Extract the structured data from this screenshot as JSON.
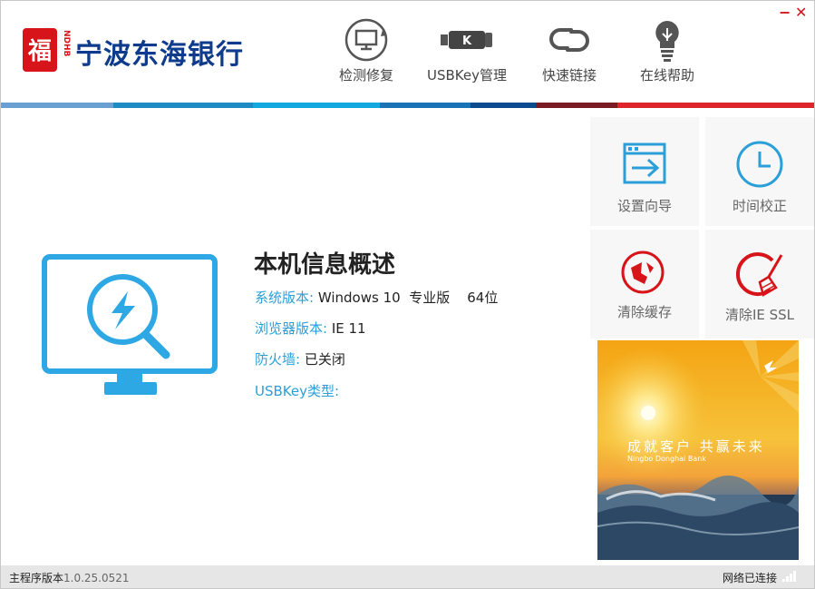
{
  "brand": {
    "name": "宁波东海银行",
    "seal_mark": "NDHB",
    "seal_glyph": "福",
    "colors": {
      "red": "#d7141a",
      "navy": "#0e3b8c",
      "accent_blue": "#2b9fd8"
    }
  },
  "window_controls": {
    "minimize": "−",
    "close": "✕"
  },
  "nav": [
    {
      "label": "检测修复",
      "icon": "monitor-refresh-icon"
    },
    {
      "label": "USBKey管理",
      "icon": "usb-key-icon",
      "badge": "K"
    },
    {
      "label": "快速链接",
      "icon": "link-icon"
    },
    {
      "label": "在线帮助",
      "icon": "lightbulb-icon"
    }
  ],
  "header_stripe_colors": [
    "#6a9fd4",
    "#1e8bc3",
    "#12a8e0",
    "#1a73b5",
    "#0a4b8f",
    "#1d2f6a",
    "#7a1a22",
    "#e0242b"
  ],
  "info": {
    "title": "本机信息概述",
    "os_label": "系统版本:",
    "os_value": "Windows 10  专业版    64位",
    "browser_label": "浏览器版本:",
    "browser_value": "IE 11",
    "firewall_label": "防火墙:",
    "firewall_value": "已关闭",
    "usbkey_label": "USBKey类型:",
    "usbkey_value": ""
  },
  "tiles": [
    {
      "label": "设置向导",
      "icon": "setup-wizard-icon"
    },
    {
      "label": "时间校正",
      "icon": "clock-icon"
    },
    {
      "label": "清除缓存",
      "icon": "clear-cache-icon"
    },
    {
      "label": "清除IE SSL",
      "icon": "clear-ssl-icon"
    }
  ],
  "banner": {
    "slogan": "成就客户 共赢未来",
    "slogan_en": "Ningbo Donghai Bank"
  },
  "status": {
    "version_label": "主程序版本",
    "version_value": "1.0.25.0521",
    "network": "网络已连接"
  }
}
